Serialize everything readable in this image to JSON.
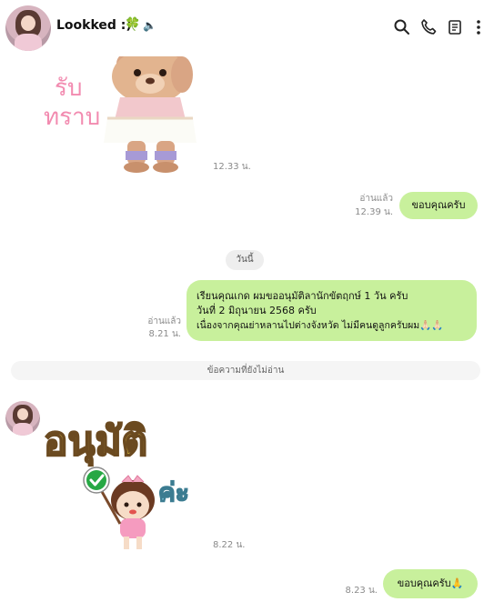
{
  "header": {
    "contact_name": "Lookked :)",
    "clover_icon": "four-leaf-clover-icon",
    "speaker_icon": "speaker-muted-icon",
    "actions": [
      "search-icon",
      "phone-icon",
      "notes-icon",
      "more-vertical-icon"
    ]
  },
  "messages": {
    "sticker1": {
      "text_line1": "รับ",
      "text_line2": "ทราบ",
      "time": "12.33 น."
    },
    "out1": {
      "text": "ขอบคุณครับ",
      "read": "อ่านแล้ว",
      "time": "12.39 น."
    },
    "date_separator": "วันนี้",
    "out2": {
      "line1": "เรียนคุณเกด ผมขออนุมัติลานักขัตฤกษ์  1 วัน ครับ",
      "line2": "วันที่ 2 มิถุนายน 2568 ครับ",
      "line3": "เนื่องจากคุณย่าหลานไปต่างจังหวัด ไม่มีคนดูลูกครับผม🙏🏻🙏🏻",
      "read": "อ่านแล้ว",
      "time": "8.21 น."
    },
    "unread_divider": "ข้อความที่ยังไม่อ่าน",
    "sticker2": {
      "text_main": "อนุมัติ",
      "text_sub": "ค่ะ",
      "time": "8.22 น."
    },
    "out3": {
      "text": "ขอบคุณครับ🙏",
      "time": "8.23 น."
    }
  },
  "colors": {
    "bubble": "#c8f09c",
    "pill": "#eeeeee",
    "sticker1_text": "#f28bb0",
    "sticker2_text": "#f7d84a",
    "check": "#27a844"
  }
}
